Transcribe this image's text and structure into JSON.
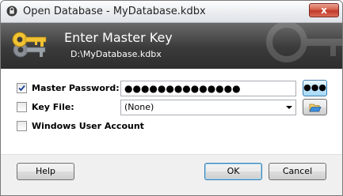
{
  "window": {
    "title": "Open Database - MyDatabase.kdbx",
    "close_label": "x"
  },
  "banner": {
    "title": "Enter Master Key",
    "subtitle": "D:\\MyDatabase.kdbx"
  },
  "form": {
    "master_password": {
      "label": "Master Password:",
      "checked": true,
      "value": "●●●●●●●●●●●●●●",
      "reveal_label": "●●●"
    },
    "key_file": {
      "label": "Key File:",
      "checked": false,
      "selected": "(None)"
    },
    "windows_account": {
      "label": "Windows User Account",
      "checked": false
    }
  },
  "footer": {
    "help_label": "Help",
    "ok_label": "OK",
    "cancel_label": "Cancel"
  },
  "colors": {
    "accent_border": "#3c7fb1",
    "banner_dark": "#2e2e2e",
    "close_red": "#c0392b"
  }
}
